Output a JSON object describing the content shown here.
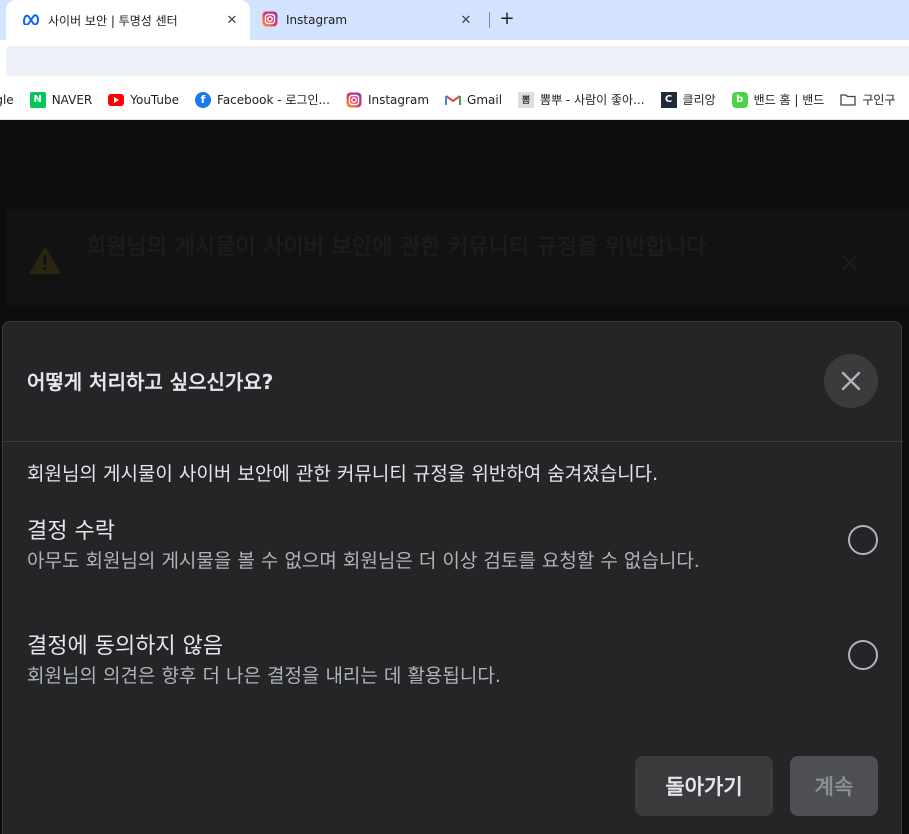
{
  "browser": {
    "tabs": [
      {
        "title": "사이버 보안 | 투명성 센터",
        "icon": "meta-icon",
        "active": true
      },
      {
        "title": "Instagram",
        "icon": "instagram-icon",
        "active": false
      }
    ],
    "bookmarks": [
      {
        "label": "ogle",
        "icon": ""
      },
      {
        "label": "NAVER",
        "icon": "N"
      },
      {
        "label": "YouTube",
        "icon": "youtube-icon"
      },
      {
        "label": "Facebook - 로그인...",
        "icon": "facebook-icon"
      },
      {
        "label": "Instagram",
        "icon": "instagram-icon"
      },
      {
        "label": "Gmail",
        "icon": "gmail-icon"
      },
      {
        "label": "뽐뿌 - 사람이 좋아...",
        "icon": "뽐"
      },
      {
        "label": "클리앙",
        "icon": "C"
      },
      {
        "label": "밴드 홈 | 밴드",
        "icon": "band-icon"
      },
      {
        "label": "구인구",
        "icon": "folder-icon"
      }
    ]
  },
  "background": {
    "banner_text": "회원님의 게시물이 사이버 보안에 관한 커뮤니티 규정을 위반합니다"
  },
  "dialog": {
    "title": "어떻게 처리하고 싶으신가요?",
    "description": "회원님의 게시물이 사이버 보안에 관한 커뮤니티 규정을 위반하여 숨겨졌습니다.",
    "options": [
      {
        "title": "결정 수락",
        "subtitle": "아무도 회원님의 게시물을 볼 수 없으며 회원님은 더 이상 검토를 요청할 수 없습니다.",
        "selected": false
      },
      {
        "title": "결정에 동의하지 않음",
        "subtitle": "회원님의 의견은 향후 더 나은 결정을 내리는 데 활용됩니다.",
        "selected": false
      }
    ],
    "back_label": "돌아가기",
    "continue_label": "계속"
  },
  "colors": {
    "dialog_bg": "#242526",
    "text_primary": "#e4e6eb",
    "text_secondary": "#b0b3b8",
    "tab_strip": "#d3e3fd"
  }
}
